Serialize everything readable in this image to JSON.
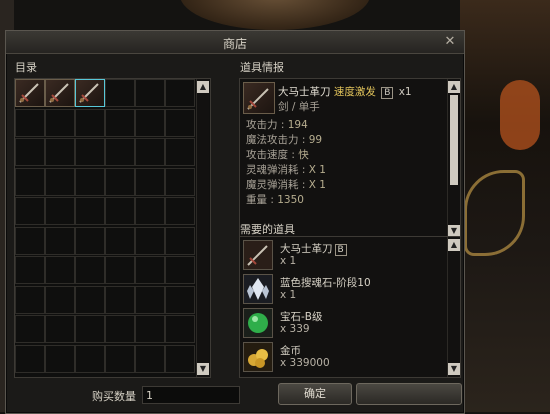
{
  "window": {
    "title": "商店"
  },
  "left": {
    "label": "目录",
    "slots": [
      {
        "icon": "sword-icon",
        "selected": false
      },
      {
        "icon": "sword-icon",
        "selected": false
      },
      {
        "icon": "sword-icon",
        "selected": true
      }
    ]
  },
  "info": {
    "label": "道具情报",
    "item_name": "大马士革刀",
    "item_tag": "速度激发",
    "grade_badge": "B",
    "item_count": "x1",
    "type_line": "剑 / 单手",
    "stats": [
      {
        "label": "攻击力",
        "value": "194"
      },
      {
        "label": "魔法攻击力",
        "value": "99"
      },
      {
        "label": "攻击速度",
        "value": "快"
      },
      {
        "label": "灵魂弹消耗",
        "value": "X 1"
      },
      {
        "label": "魔灵弹消耗",
        "value": "X 1"
      },
      {
        "label": "重量",
        "value": "1350"
      }
    ]
  },
  "required": {
    "label": "需要的道具",
    "items": [
      {
        "name": "大马士革刀",
        "badge": "B",
        "qty": "x 1",
        "icon": "sword-icon"
      },
      {
        "name": "蓝色搜魂石-阶段10",
        "badge": "",
        "qty": "x 1",
        "icon": "crystal-icon"
      },
      {
        "name": "宝石-B级",
        "badge": "",
        "qty": "x 339",
        "icon": "gem-icon"
      },
      {
        "name": "金币",
        "badge": "",
        "qty": "x 339000",
        "icon": "coin-icon"
      }
    ]
  },
  "footer": {
    "qty_label": "购买数量",
    "qty_value": "1",
    "confirm_label": "确定"
  },
  "colors": {
    "accent_yellow": "#e2c45b",
    "selection_cyan": "#58c8d8"
  }
}
